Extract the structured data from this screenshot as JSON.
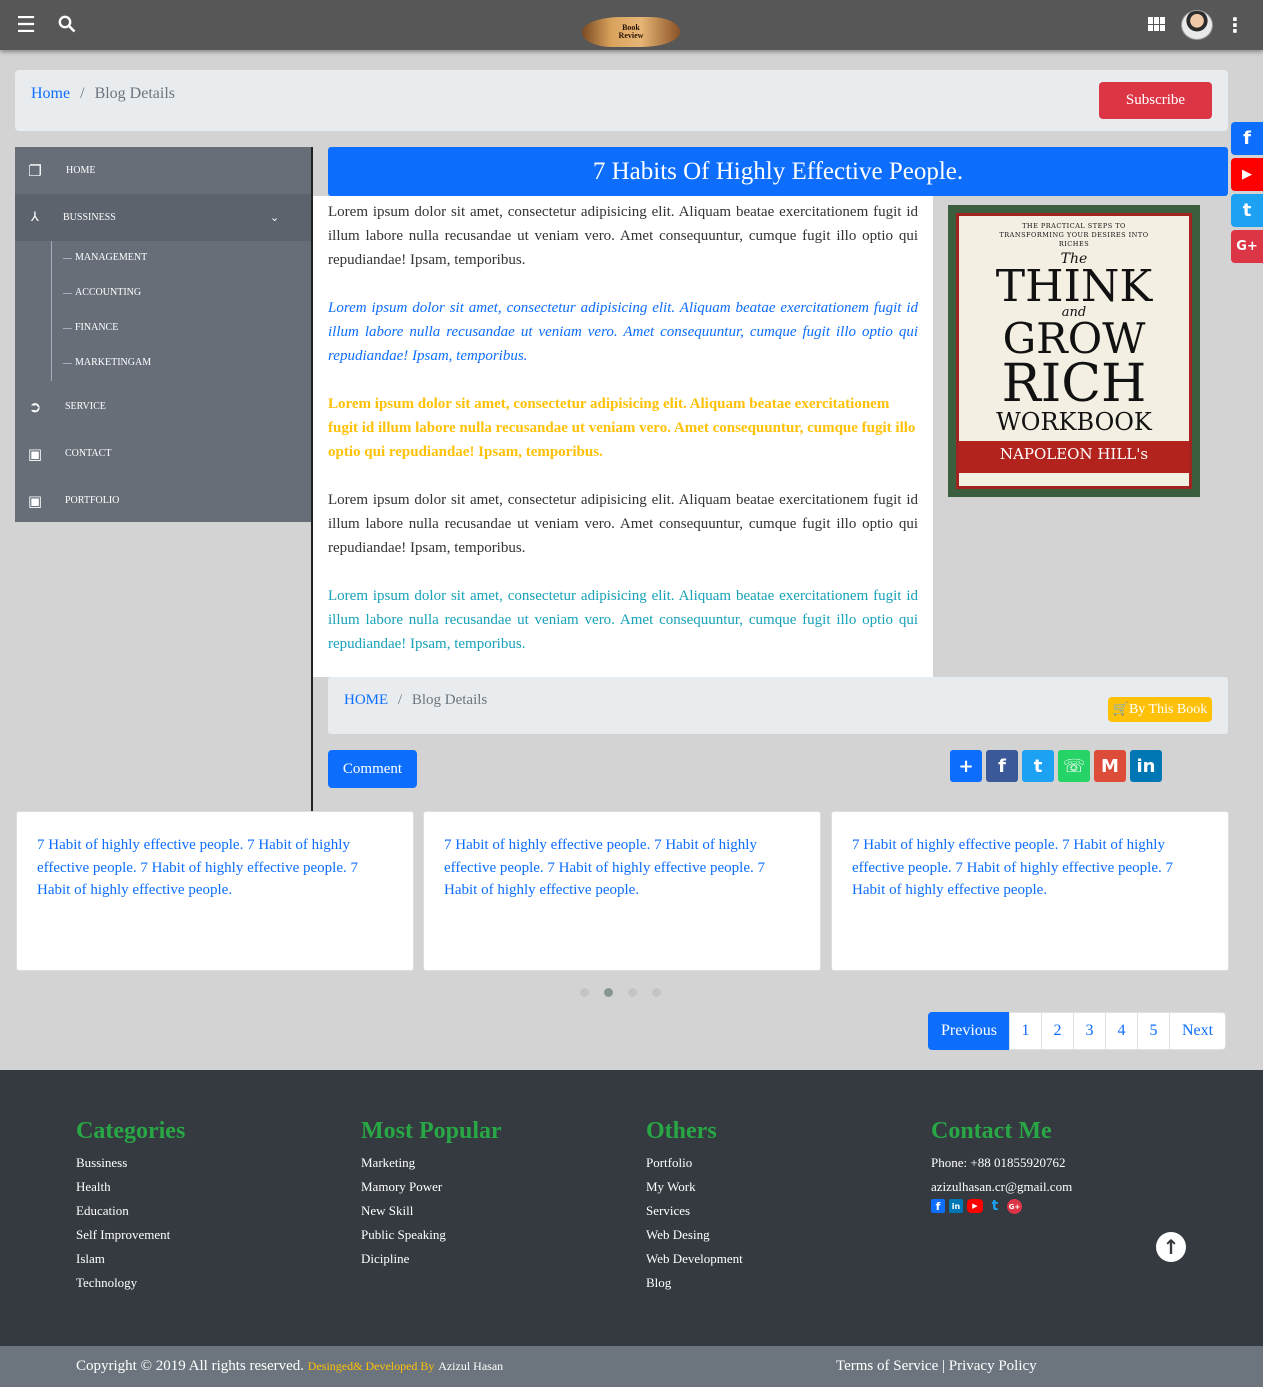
{
  "header": {
    "menu_icon": "hamburger-icon",
    "search_icon": "search-icon",
    "logo_line1": "Book",
    "logo_line2": "Review",
    "apps_icon": "grid-icon",
    "more_icon": "kebab-icon"
  },
  "breadcrumb": {
    "home": "Home",
    "separator": "/",
    "current": "Blog Details"
  },
  "subscribe_label": "Subscribe",
  "side_social": [
    "f",
    "▶",
    "t",
    "G+"
  ],
  "sidebar": {
    "home": "HOME",
    "business": "BUSSINESS",
    "sub_items": [
      "MANAGEMENT",
      "ACCOUNTING",
      "FINANCE",
      "MARKETINGAM"
    ],
    "service": "SERVICE",
    "contact": "CONTACT",
    "portfolio": "PORTFOLIO"
  },
  "article": {
    "title": "7 Habits Of Highly Effective People.",
    "paragraphs": [
      "Lorem ipsum dolor sit amet, consectetur adipisicing elit. Aliquam beatae exercitationem fugit id illum labore nulla recusandae ut veniam vero. Amet consequuntur, cumque fugit illo optio qui repudiandae! Ipsam, temporibus.",
      "Lorem ipsum dolor sit amet, consectetur adipisicing elit. Aliquam beatae exercitationem fugit id illum labore nulla recusandae ut veniam vero. Amet consequuntur, cumque fugit illo optio qui repudiandae! Ipsam, temporibus.",
      "Lorem ipsum dolor sit amet, consectetur adipisicing elit. Aliquam beatae exercitationem fugit id illum labore nulla recusandae ut veniam vero. Amet consequuntur, cumque fugit illo optio qui repudiandae! Ipsam, temporibus.",
      "Lorem ipsum dolor sit amet, consectetur adipisicing elit. Aliquam beatae exercitationem fugit id illum labore nulla recusandae ut veniam vero. Amet consequuntur, cumque fugit illo optio qui repudiandae! Ipsam, temporibus.",
      "Lorem ipsum dolor sit amet, consectetur adipisicing elit. Aliquam beatae exercitationem fugit id illum labore nulla recusandae ut veniam vero. Amet consequuntur, cumque fugit illo optio qui repudiandae! Ipsam, temporibus."
    ],
    "paragraph_colors": [
      "#333333",
      "#0d6efd",
      "#ffc107",
      "#333333",
      "#17a2b8"
    ]
  },
  "book_cover": {
    "tagline": "THE PRACTICAL STEPS TO TRANSFORMING YOUR DESIRES INTO RICHES",
    "the": "The",
    "think": "THINK",
    "and": "and",
    "grow": "GROW",
    "rich": "RICH",
    "workbook": "WORKBOOK",
    "author": "NAPOLEON HILL's"
  },
  "breadcrumb2": {
    "home": "HOME",
    "separator": "/",
    "current": "Blog Details"
  },
  "buy_label": "By This Book",
  "comment_label": "Comment",
  "share_buttons": [
    {
      "icon": "+",
      "color": "#0d6efd"
    },
    {
      "icon": "f",
      "color": "#3b5998"
    },
    {
      "icon": "t",
      "color": "#1da1f2"
    },
    {
      "icon": "☏",
      "color": "#25d366"
    },
    {
      "icon": "M",
      "color": "#dd4b39"
    },
    {
      "icon": "in",
      "color": "#0077b5"
    }
  ],
  "cards": [
    "7 Habit of highly effective people. 7 Habit of highly effective people. 7 Habit of highly effective people. 7 Habit of highly effective people.",
    "7 Habit of highly effective people. 7 Habit of highly effective people. 7 Habit of highly effective people. 7 Habit of highly effective people.",
    "7 Habit of highly effective people. 7 Habit of highly effective people. 7 Habit of highly effective people. 7 Habit of highly effective people."
  ],
  "pagination": [
    "Previous",
    "1",
    "2",
    "3",
    "4",
    "5",
    "Next"
  ],
  "footer": {
    "categories": {
      "title": "Categories",
      "items": [
        "Bussiness",
        "Health",
        "Education",
        "Self Improvement",
        "Islam",
        "Technology"
      ]
    },
    "popular": {
      "title": "Most Popular",
      "items": [
        "Marketing",
        "Mamory Power",
        "New Skill",
        "Public Speaking",
        "Dicipline"
      ]
    },
    "others": {
      "title": "Others",
      "items": [
        "Portfolio",
        "My Work",
        "Services",
        "Web Desing",
        "Web Development",
        "Blog"
      ]
    },
    "contact": {
      "title": "Contact Me",
      "phone": "Phone: +88 01855920762",
      "email": "azizulhasan.cr@gmail.com"
    }
  },
  "copyright": {
    "text": "Copyright © 2019 All rights reserved.",
    "designed": "Desinged& Developed By",
    "author": "Azizul Hasan",
    "terms": "Terms of Service",
    "sep": "|",
    "privacy": "Privacy Policy"
  }
}
